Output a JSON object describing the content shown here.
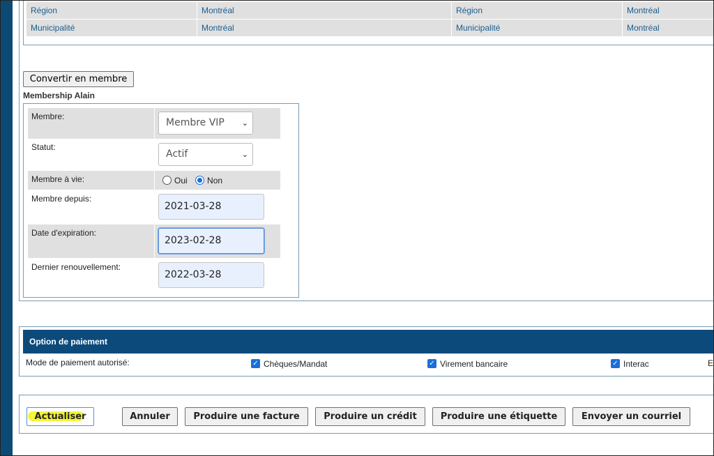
{
  "region_table": {
    "rows": [
      [
        "Région",
        "Montréal",
        "Région",
        "Montréal"
      ],
      [
        "Municipalité",
        "Montréal",
        "Municipalité",
        "Montréal"
      ]
    ]
  },
  "convert_button": "Convertir en membre",
  "membership": {
    "title": "Membership Alain",
    "membre_label": "Membre:",
    "membre_value": "Membre VIP",
    "statut_label": "Statut:",
    "statut_value": "Actif",
    "a_vie_label": "Membre à vie:",
    "oui_label": "Oui",
    "non_label": "Non",
    "a_vie_selected": "Non",
    "depuis_label": "Membre depuis:",
    "depuis_value": "2021-03-28",
    "expiration_label": "Date d'expiration:",
    "expiration_value": "2023-02-28",
    "renouvellement_label": "Dernier renouvellement:",
    "renouvellement_value": "2022-03-28"
  },
  "payment": {
    "header": "Option de paiement",
    "mode_label": "Mode de paiement autorisé:",
    "options": [
      {
        "label": "Chèques/Mandat",
        "checked": true
      },
      {
        "label": "Virement bancaire",
        "checked": true
      },
      {
        "label": "Interac",
        "checked": true
      }
    ],
    "truncated": "E"
  },
  "actions": {
    "actualiser": "Actualiser",
    "annuler": "Annuler",
    "facture": "Produire une facture",
    "credit": "Produire un crédit",
    "etiquette": "Produire une étiquette",
    "courriel": "Envoyer un courriel"
  },
  "colors": {
    "header_bg": "#0d4a7c",
    "link_text": "#1a5d8c",
    "highlight": "#f5f538"
  }
}
